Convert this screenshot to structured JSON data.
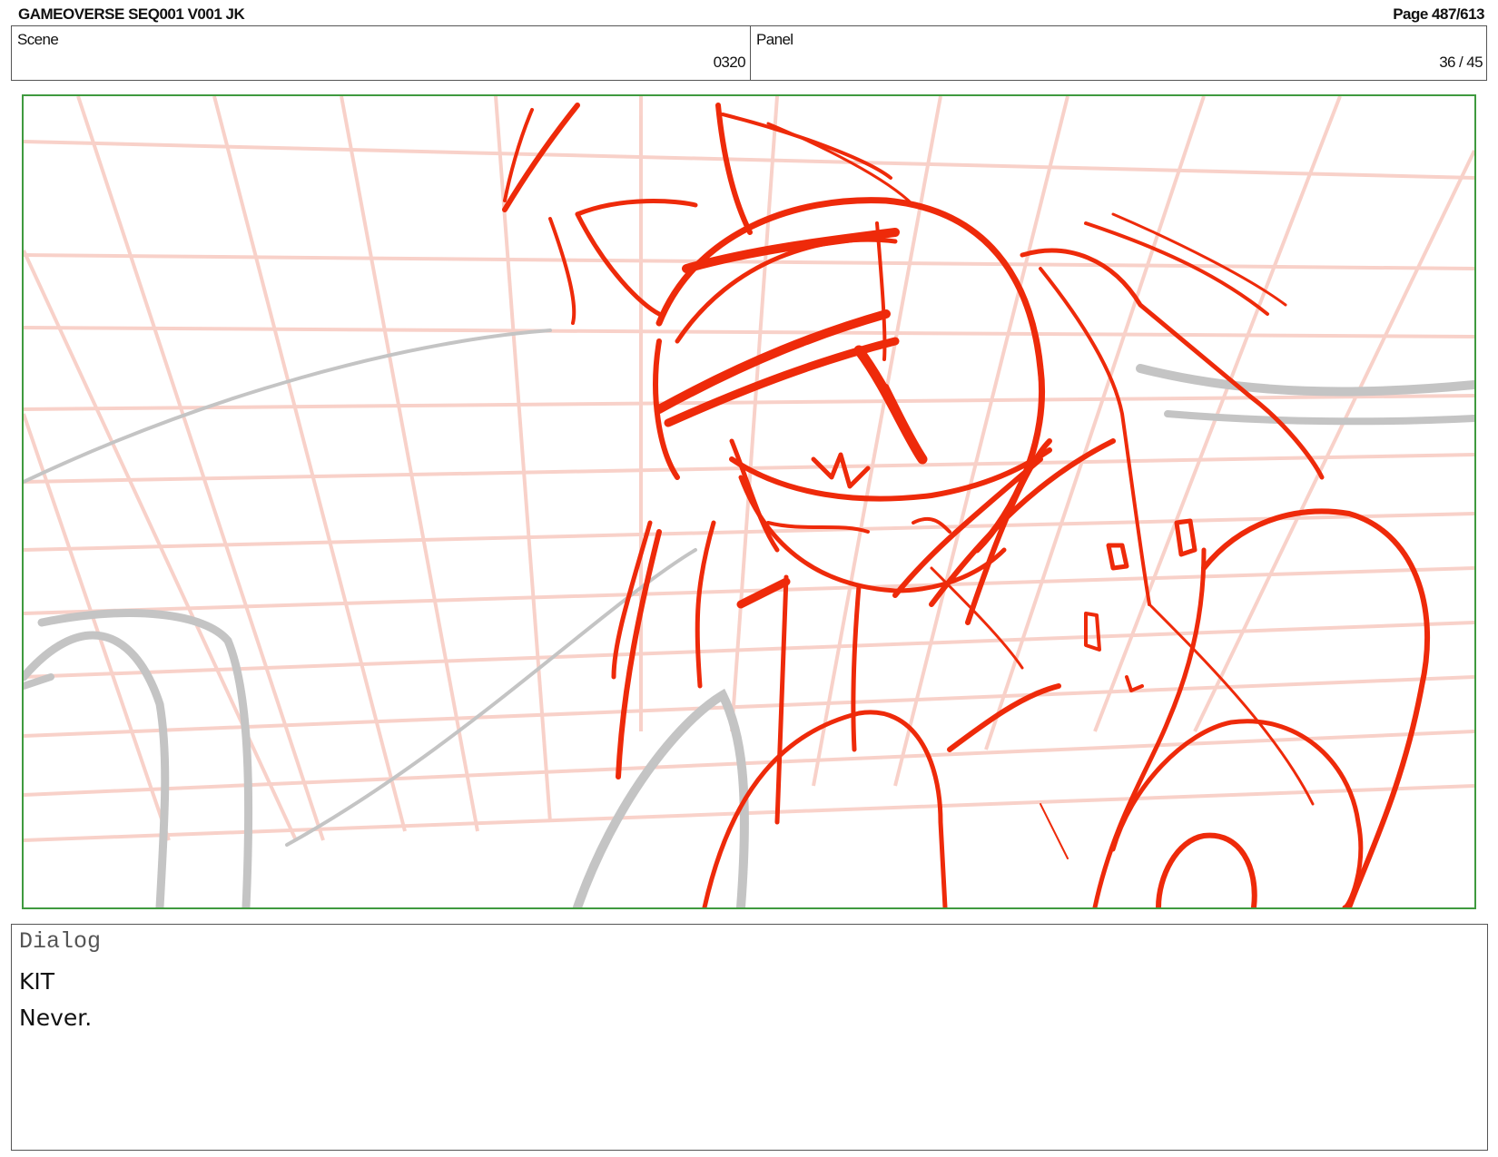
{
  "header": {
    "title": "GAMEOVERSE SEQ001 V001 JK",
    "page": "Page 487/613"
  },
  "info": {
    "scene_label": "Scene",
    "scene_value": "0320",
    "panel_label": "Panel",
    "panel_value": "36 / 45"
  },
  "panel_image": {
    "description_icon": "storyboard-sketch",
    "frame_color": "#3f9a3f",
    "line_color": "#ee2a0a",
    "grid_color": "#f8c8c0",
    "rough_color": "#c8c8c8"
  },
  "dialog": {
    "label": "Dialog",
    "speaker": "KIT",
    "line": "Never."
  }
}
